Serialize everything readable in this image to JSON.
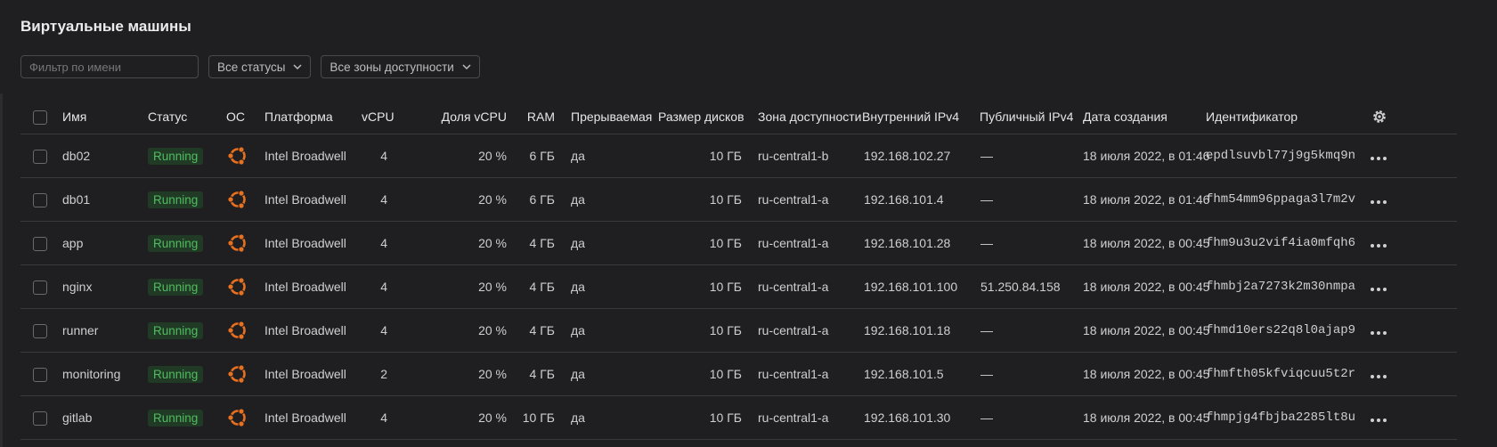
{
  "page": {
    "title": "Виртуальные машины"
  },
  "filters": {
    "name_placeholder": "Фильтр по имени",
    "status_select": "Все статусы",
    "zone_select": "Все зоны доступности"
  },
  "columns": {
    "name": "Имя",
    "status": "Статус",
    "os": "ОС",
    "platform": "Платформа",
    "vcpu": "vCPU",
    "vcpu_share": "Доля vCPU",
    "ram": "RAM",
    "preemptible": "Прерываемая",
    "disk": "Размер дисков",
    "zone": "Зона доступности",
    "ipv4_internal": "Внутренний IPv4",
    "ipv4_public": "Публичный IPv4",
    "created": "Дата создания",
    "id": "Идентификатор"
  },
  "colors": {
    "accent_os": "#e8701f",
    "status_running": "#4fbd5f"
  },
  "rows": [
    {
      "name": "db02",
      "status": "Running",
      "platform": "Intel Broadwell",
      "vcpu": "4",
      "vcpu_share": "20 %",
      "ram": "6 ГБ",
      "preemptible": "да",
      "disk": "10 ГБ",
      "zone": "ru-central1-b",
      "ipv4_internal": "192.168.102.27",
      "ipv4_public": "—",
      "created": "18 июля 2022, в 01:46",
      "id": "epdlsuvbl77j9g5kmq9n"
    },
    {
      "name": "db01",
      "status": "Running",
      "platform": "Intel Broadwell",
      "vcpu": "4",
      "vcpu_share": "20 %",
      "ram": "6 ГБ",
      "preemptible": "да",
      "disk": "10 ГБ",
      "zone": "ru-central1-a",
      "ipv4_internal": "192.168.101.4",
      "ipv4_public": "—",
      "created": "18 июля 2022, в 01:46",
      "id": "fhm54mm96ppaga3l7m2v"
    },
    {
      "name": "app",
      "status": "Running",
      "platform": "Intel Broadwell",
      "vcpu": "4",
      "vcpu_share": "20 %",
      "ram": "4 ГБ",
      "preemptible": "да",
      "disk": "10 ГБ",
      "zone": "ru-central1-a",
      "ipv4_internal": "192.168.101.28",
      "ipv4_public": "—",
      "created": "18 июля 2022, в 00:45",
      "id": "fhm9u3u2vif4ia0mfqh6"
    },
    {
      "name": "nginx",
      "status": "Running",
      "platform": "Intel Broadwell",
      "vcpu": "4",
      "vcpu_share": "20 %",
      "ram": "4 ГБ",
      "preemptible": "да",
      "disk": "10 ГБ",
      "zone": "ru-central1-a",
      "ipv4_internal": "192.168.101.100",
      "ipv4_public": "51.250.84.158",
      "created": "18 июля 2022, в 00:45",
      "id": "fhmbj2a7273k2m30nmpa"
    },
    {
      "name": "runner",
      "status": "Running",
      "platform": "Intel Broadwell",
      "vcpu": "4",
      "vcpu_share": "20 %",
      "ram": "4 ГБ",
      "preemptible": "да",
      "disk": "10 ГБ",
      "zone": "ru-central1-a",
      "ipv4_internal": "192.168.101.18",
      "ipv4_public": "—",
      "created": "18 июля 2022, в 00:45",
      "id": "fhmd10ers22q8l0ajap9"
    },
    {
      "name": "monitoring",
      "status": "Running",
      "platform": "Intel Broadwell",
      "vcpu": "2",
      "vcpu_share": "20 %",
      "ram": "4 ГБ",
      "preemptible": "да",
      "disk": "10 ГБ",
      "zone": "ru-central1-a",
      "ipv4_internal": "192.168.101.5",
      "ipv4_public": "—",
      "created": "18 июля 2022, в 00:45",
      "id": "fhmfth05kfviqcuu5t2r"
    },
    {
      "name": "gitlab",
      "status": "Running",
      "platform": "Intel Broadwell",
      "vcpu": "4",
      "vcpu_share": "20 %",
      "ram": "10 ГБ",
      "preemptible": "да",
      "disk": "10 ГБ",
      "zone": "ru-central1-a",
      "ipv4_internal": "192.168.101.30",
      "ipv4_public": "—",
      "created": "18 июля 2022, в 00:45",
      "id": "fhmpjg4fbjba2285lt8u"
    }
  ]
}
